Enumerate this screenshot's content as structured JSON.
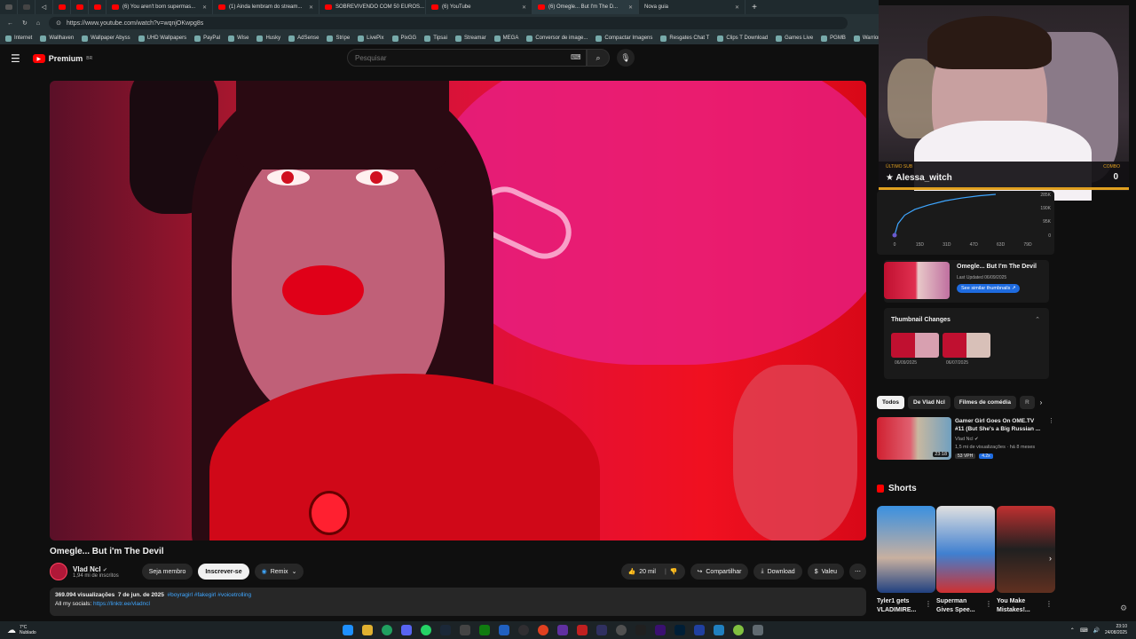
{
  "browser": {
    "tabs": [
      {
        "label": "(6) You aren't born supermas..."
      },
      {
        "label": "(1) Ainda lembram do stream..."
      },
      {
        "label": "SOBREVIVENDO COM 50 EUROS..."
      },
      {
        "label": "(6) YouTube"
      },
      {
        "label": "(6) Omegle... But I'm The D..."
      },
      {
        "label": "Nova guia"
      }
    ],
    "url": "https://www.youtube.com/watch?v=wqnjOKwpg8s",
    "bookmarks": [
      "Internet",
      "Wallhaven",
      "Wallpaper Abyss",
      "UHD Wallpapers",
      "PayPal",
      "Wise",
      "Husky",
      "AdSense",
      "Stripe",
      "LivePix",
      "PixGG",
      "Tipsai",
      "Streamar",
      "MEGA",
      "Conversor de image...",
      "Compactar Imagens",
      "Resgates Chat T",
      "Clips T Download",
      "Games Live",
      "PGMB",
      "Warrior"
    ]
  },
  "header": {
    "logo_text": "Premium",
    "region": "BR",
    "search_placeholder": "Pesquisar"
  },
  "video": {
    "title": "Omegle... But i'm The Devil",
    "channel": "Vlad Ncl",
    "subscribers": "1,94 mi de inscritos",
    "member_button": "Seja membro",
    "subscribe_button": "Inscrever-se",
    "remix_button": "Remix",
    "likes": "20 mil",
    "share_button": "Compartilhar",
    "download_button": "Download",
    "thanks_button": "Valeu",
    "views": "369.094 visualizações",
    "date": "7 de jun. de 2025",
    "hashtags": "#boyragirl #fakegirl #voicetrolling",
    "social_label": "All my socials:",
    "social_link": "https://linktr.ee/vladncl"
  },
  "analytics": {
    "y_ticks": [
      "285K",
      "190K",
      "95K",
      "0"
    ],
    "x_ticks": [
      "0",
      "15D",
      "31D",
      "47D",
      "63D",
      "79D"
    ],
    "thumb_title": "Omegle... But I'm The Devil",
    "thumb_updated": "Last Updated 06/09/2025",
    "thumb_button": "See similar thumbnails ↗",
    "changes_title": "Thumbnail Changes",
    "change_dates": [
      "06/09/2025",
      "06/07/2025"
    ]
  },
  "chips": [
    "Todos",
    "De Vlad Ncl",
    "Filmes de comédia",
    "R"
  ],
  "recommendation": {
    "title": "Gamer Girl Goes On OME.TV #11 (But She's a Big Russian ...",
    "channel": "Vlad Ncl",
    "meta": "1,5 mi de visualizações · há 8 meses",
    "duration": "23:18",
    "vph": "53 VPH",
    "mult": "4.2x"
  },
  "shorts": {
    "heading": "Shorts",
    "items": [
      {
        "title": "Tyler1 gets VLADIMIRE..."
      },
      {
        "title": "Superman Gives Spee..."
      },
      {
        "title": "You Make Mistakes!..."
      }
    ]
  },
  "stream_overlay": {
    "label": "ÚLTIMO SUB",
    "name": "Alessa_witch",
    "combo_label": "COMBO",
    "combo_value": "0"
  },
  "taskbar": {
    "weather_temp": "7°C",
    "weather_text": "Nublado",
    "time": "23:10",
    "date": "24/08/2025"
  },
  "chart_data": {
    "type": "line",
    "x": [
      0,
      2,
      6,
      12,
      20,
      30,
      40,
      50,
      60
    ],
    "y": [
      0,
      80000,
      140000,
      180000,
      210000,
      240000,
      260000,
      275000,
      285000
    ],
    "xlabel": "",
    "ylabel": "",
    "ylim": [
      0,
      285000
    ],
    "x_ticks": [
      "0",
      "15D",
      "31D",
      "47D",
      "63D",
      "79D"
    ],
    "y_ticks": [
      "285K",
      "190K",
      "95K",
      "0"
    ]
  }
}
